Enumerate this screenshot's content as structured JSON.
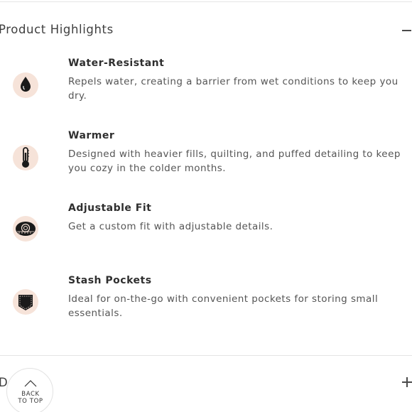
{
  "section": {
    "title": "Product Highlights",
    "expanded": true,
    "toggle_icon": "minus-icon"
  },
  "features": [
    {
      "icon": "water-drop-icon",
      "title": "Water-Resistant",
      "description": "Repels water, creating a barrier from wet conditions to keep you dry."
    },
    {
      "icon": "thermometer-icon",
      "title": "Warmer",
      "description": "Designed with heavier fills, quilting, and puffed detailing to keep you cozy in the colder months."
    },
    {
      "icon": "measuring-tape-icon",
      "title": "Adjustable Fit",
      "description": "Get a custom fit with adjustable details."
    },
    {
      "icon": "pocket-icon",
      "title": "Stash Pockets",
      "description": "Ideal for on-the-go with convenient pockets for storing small essentials."
    }
  ],
  "next_section": {
    "title": "D",
    "toggle_icon": "plus-icon"
  },
  "back_to_top": {
    "label": "BACK\nTO TOP"
  },
  "colors": {
    "icon_background": "#f6e3d9",
    "icon_foreground": "#1a1a1a",
    "divider": "#e6e6e6"
  }
}
